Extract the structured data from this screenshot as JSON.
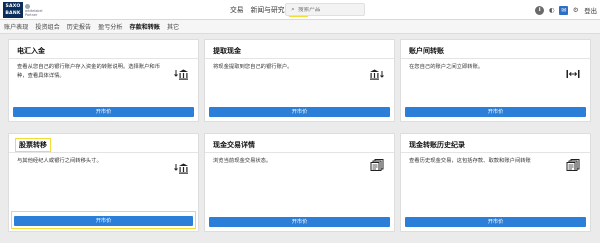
{
  "header": {
    "logo_line1": "SAXO",
    "logo_line2": "BANK",
    "logo_sub_line1": "whitelabel",
    "logo_sub_line2": "Partner",
    "nav": [
      {
        "label": "交易"
      },
      {
        "label": "新闻与研究"
      },
      {
        "label": "账户",
        "active": true
      }
    ],
    "search_placeholder": "搜索产品",
    "logout_label": "登出"
  },
  "subnav": [
    {
      "label": "账户表现"
    },
    {
      "label": "投资组合"
    },
    {
      "label": "历史报告"
    },
    {
      "label": "盈亏分析"
    },
    {
      "label": "存款和转账",
      "active": true
    },
    {
      "label": "其它"
    }
  ],
  "cards": [
    {
      "title": "电汇入金",
      "description": "查看从您自己的银行账户存入资金的转账说明。选择账户和币种，查看具体详情。",
      "icon": "bank-deposit-icon",
      "button": "开市价"
    },
    {
      "title": "提取现金",
      "description": "将现金提取到您自己的银行账户。",
      "icon": "bank-withdraw-icon",
      "button": "开市价"
    },
    {
      "title": "账户间转账",
      "description": "在您自己的账户之间立即转账。",
      "icon": "transfer-arrows-icon",
      "button": "开市价"
    },
    {
      "title": "股票转移",
      "description": "与其他经纪人或银行之间转移头寸。",
      "icon": "bank-transfer-icon",
      "button": "开市价",
      "highlight": true
    },
    {
      "title": "现金交易详情",
      "description": "浏览当前现金交易状态。",
      "icon": "documents-icon",
      "button": "开市价"
    },
    {
      "title": "现金转账历史纪录",
      "description": "查看历史现金交易，这包括存款、取款和账户间转账",
      "icon": "documents-icon",
      "button": "开市价"
    }
  ],
  "colors": {
    "brand_navy": "#0b2d5b",
    "button_blue": "#2b7fd8",
    "highlight_yellow": "#f3dd3a",
    "page_bg": "#ebebeb"
  }
}
